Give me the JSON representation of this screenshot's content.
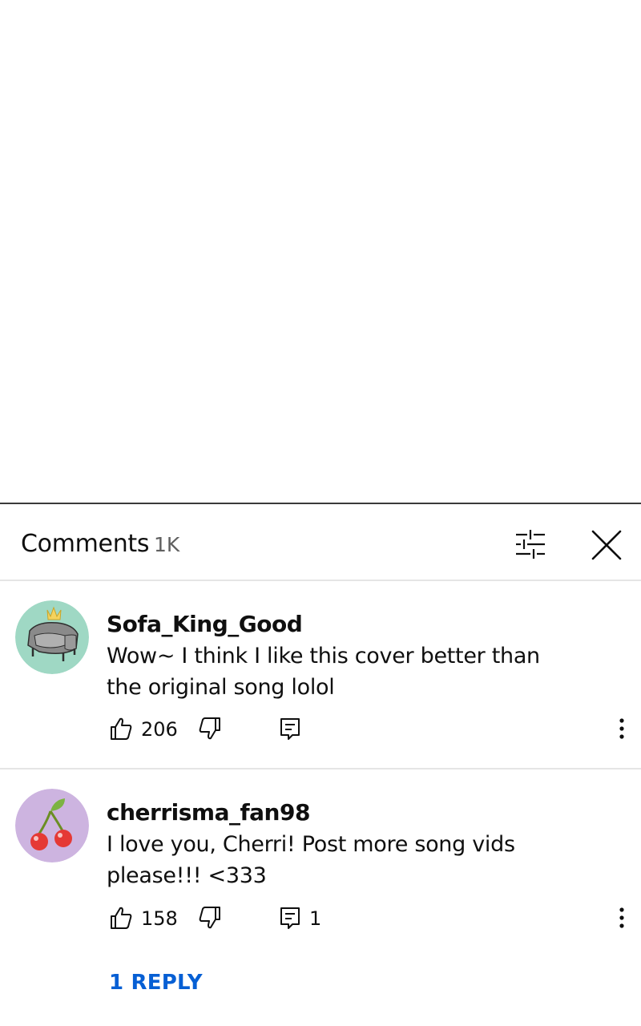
{
  "panel": {
    "title": "Comments",
    "count": "1K"
  },
  "icons": {
    "filter": "filter-sliders-icon",
    "close": "close-icon",
    "like": "thumbs-up-icon",
    "dislike": "thumbs-down-icon",
    "reply": "reply-comment-icon",
    "more": "more-vertical-icon"
  },
  "colors": {
    "link": "#065fd4",
    "text": "#0f0f0f",
    "secondary": "#606060",
    "avatar1_bg": "#9fd8c4",
    "avatar2_bg": "#cdb4e0"
  },
  "comments": [
    {
      "author": "Sofa_King_Good",
      "text": "Wow~ I think I like this cover better than the original song lolol",
      "likes": "206",
      "replies": "",
      "avatar": "sofa-crown-avatar"
    },
    {
      "author": "cherrisma_fan98",
      "text": "I love you, Cherri! Post more song vids please!!! <333",
      "likes": "158",
      "replies": "1",
      "replies_link": "1 REPLY",
      "avatar": "cherry-avatar"
    }
  ]
}
